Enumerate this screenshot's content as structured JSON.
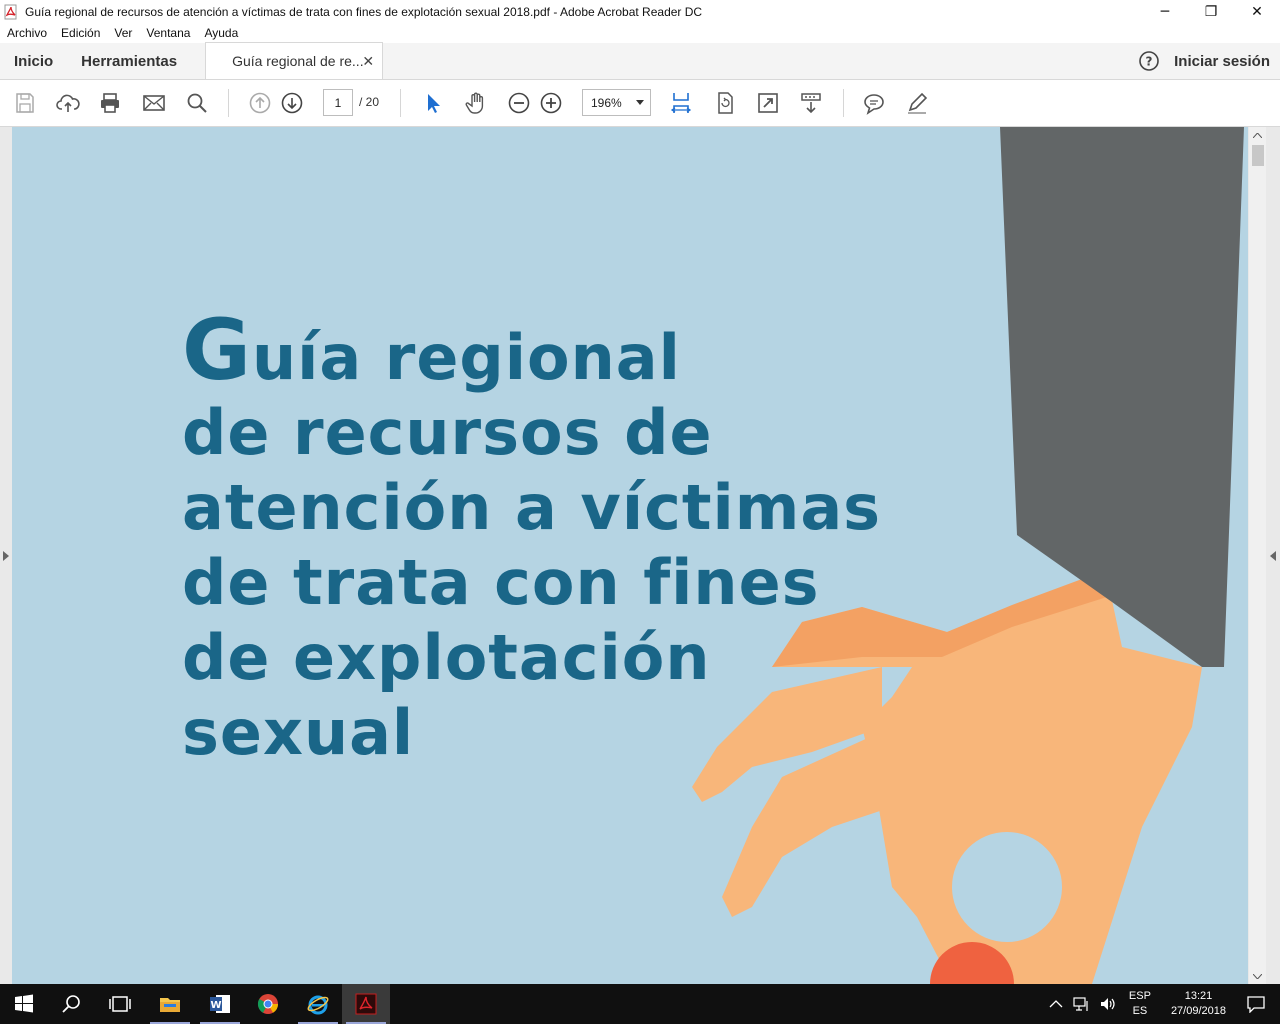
{
  "window": {
    "title": "Guía regional de recursos de atención a víctimas de trata con fines de explotación sexual 2018.pdf - Adobe Acrobat Reader DC",
    "minimize": "─",
    "restore": "❐",
    "close": "✕"
  },
  "menu": [
    "Archivo",
    "Edición",
    "Ver",
    "Ventana",
    "Ayuda"
  ],
  "tabs": {
    "home": "Inicio",
    "tools": "Herramientas",
    "document": "Guía regional de re...",
    "close": "✕",
    "signin": "Iniciar sesión"
  },
  "toolbar": {
    "page_current": "1",
    "page_total": "/ 20",
    "zoom": "196%"
  },
  "document": {
    "title_lines": [
      "uía regional",
      "de recursos de",
      "atención a víctimas",
      "de trata con fines",
      "de explotación",
      "sexual"
    ],
    "title_initial": "G",
    "colors": {
      "background": "#b5d4e3",
      "title": "#1a6688",
      "sleeve": "#626667",
      "skin": "#f8b67a",
      "skin_shadow": "#f3a163",
      "ball": "#ef6240"
    }
  },
  "taskbar": {
    "lang_top": "ESP",
    "lang_bottom": "ES",
    "time": "13:21",
    "date": "27/09/2018"
  }
}
